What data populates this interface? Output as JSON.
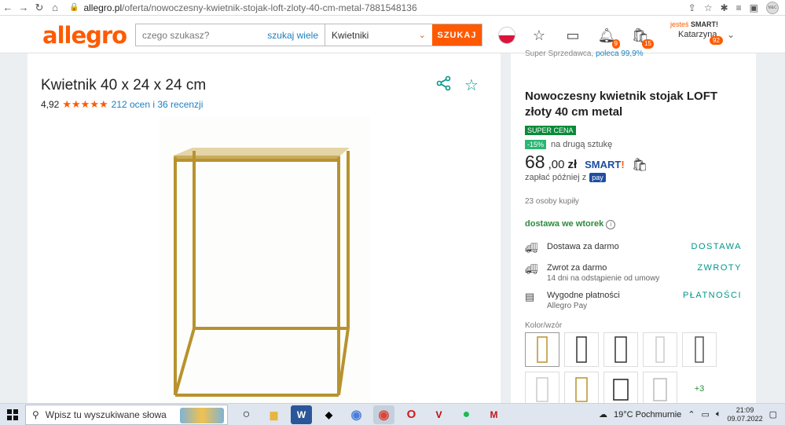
{
  "browser": {
    "url_host": "allegro.pl",
    "url_path": "/oferta/nowoczesny-kwietnik-stojak-loft-zloty-40-cm-metal-7881548136",
    "avatar_text": "M&C"
  },
  "header": {
    "logo": "allegro",
    "search_placeholder": "czego szukasz?",
    "search_many": "szukaj wiele",
    "category": "Kwietniki",
    "search_button": "SZUKAJ",
    "notif_badge": "9",
    "cart_badge": "15",
    "jestes": "jesteś",
    "smart": "SMART!",
    "user_name": "Katarzyna",
    "user_badge": "92"
  },
  "product": {
    "title": "Kwietnik 40 x 24 x 24 cm",
    "rating_value": "4,92",
    "stars": "★★★★★",
    "rating_link": "212 ocen i 36 recenzji"
  },
  "offer": {
    "seller_prefix": "Super Sprzedawca,",
    "seller_recommend": "poleca 99,9%",
    "title": "Nowoczesny kwietnik stojak LOFT złoty 40 cm metal",
    "super_cena": "SUPER CENA",
    "discount_pct": "-15%",
    "discount_text": "na drugą sztukę",
    "price_main": "68",
    "price_decimal": ",00",
    "currency": "zł",
    "smart": "SMART",
    "pay_later": "zapłać później z",
    "pay_badge": "pay",
    "bought": "23 osoby kupiły",
    "delivery_day": "dostawa we wtorek",
    "rows": [
      {
        "title": "Dostawa za darmo",
        "sub": "",
        "link": "DOSTAWA"
      },
      {
        "title": "Zwrot za darmo",
        "sub": "14 dni na odstąpienie od umowy",
        "link": "ZWROTY"
      },
      {
        "title": "Wygodne płatności",
        "sub": "Allegro Pay",
        "link": "PŁATNOŚCI"
      }
    ],
    "color_label": "Kolor/wzór",
    "more_variants": "+3"
  },
  "taskbar": {
    "search_placeholder": "Wpisz tu wyszukiwane słowa",
    "weather": "19°C  Pochmurnie",
    "time": "21:09",
    "date": "09.07.2022"
  },
  "colors": {
    "accent": "#ff5a00",
    "teal": "#009688",
    "gold": "#b8922e"
  }
}
